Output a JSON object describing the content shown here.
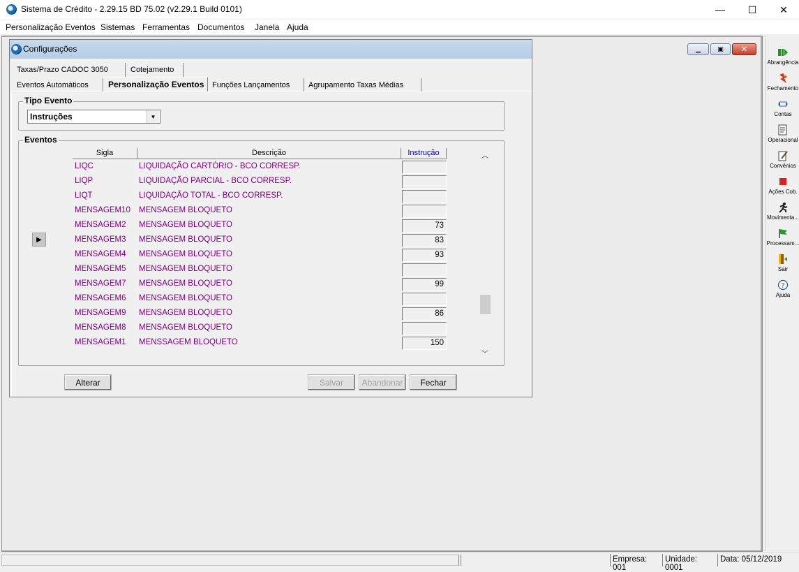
{
  "app": {
    "title": "Sistema de Crédito - 2.29.15 BD 75.02 (v2.29.1 Build 0101)",
    "controls": {
      "minimize": "—",
      "maximize": "☐",
      "close": "✕"
    }
  },
  "menu": {
    "items": [
      "Personalização Eventos",
      "Sistemas",
      "Ferramentas",
      "Documentos",
      "Janela",
      "Ajuda"
    ]
  },
  "toolbar": {
    "items": [
      {
        "label": "Abrangência",
        "icon": "abrangencia-icon"
      },
      {
        "label": "Fechamento",
        "icon": "fechamento-icon"
      },
      {
        "label": "Contas",
        "icon": "contas-icon"
      },
      {
        "label": "Operacional",
        "icon": "operacional-icon"
      },
      {
        "label": "Convênios",
        "icon": "convenios-icon"
      },
      {
        "label": "Ações Cob.",
        "icon": "acoes-cob-icon"
      },
      {
        "label": "Movimenta...",
        "icon": "movimenta-icon"
      },
      {
        "label": "Processam...",
        "icon": "processam-icon"
      },
      {
        "label": "Sair",
        "icon": "sair-icon"
      },
      {
        "label": "Ajuda",
        "icon": "help-icon"
      }
    ]
  },
  "window": {
    "title": "Configurações",
    "tabs_row1": [
      "Taxas/Prazo CADOC 3050",
      "Cotejamento"
    ],
    "tabs_row2": [
      "Eventos Automáticos",
      "Personalização Eventos",
      "Funções Lançamentos",
      "Agrupamento Taxas Médias"
    ],
    "active_tab": "Personalização Eventos"
  },
  "tipo_evento": {
    "label": "Tipo Evento",
    "selected": "Instruções"
  },
  "eventos": {
    "label": "Eventos",
    "columns": {
      "sigla": "Sigla",
      "descricao": "Descrição",
      "instrucao": "Instrução"
    },
    "rows": [
      {
        "sigla": "LIQC",
        "descricao": "LIQUIDAÇÃO CARTÓRIO - BCO CORRESP.",
        "instrucao": ""
      },
      {
        "sigla": "LIQP",
        "descricao": "LIQUIDAÇÃO PARCIAL - BCO CORRESP.",
        "instrucao": ""
      },
      {
        "sigla": "LIQT",
        "descricao": "LIQUIDAÇÃO TOTAL - BCO CORRESP.",
        "instrucao": ""
      },
      {
        "sigla": "MENSAGEM10",
        "descricao": "MENSAGEM BLOQUETO",
        "instrucao": ""
      },
      {
        "sigla": "MENSAGEM2",
        "descricao": "MENSAGEM BLOQUETO",
        "instrucao": "73"
      },
      {
        "sigla": "MENSAGEM3",
        "descricao": "MENSAGEM BLOQUETO",
        "instrucao": "83"
      },
      {
        "sigla": "MENSAGEM4",
        "descricao": "MENSAGEM BLOQUETO",
        "instrucao": "93"
      },
      {
        "sigla": "MENSAGEM5",
        "descricao": "MENSAGEM BLOQUETO",
        "instrucao": ""
      },
      {
        "sigla": "MENSAGEM7",
        "descricao": "MENSAGEM BLOQUETO",
        "instrucao": "99"
      },
      {
        "sigla": "MENSAGEM6",
        "descricao": "MENSAGEM BLOQUETO",
        "instrucao": ""
      },
      {
        "sigla": "MENSAGEM9",
        "descricao": "MENSAGEM BLOQUETO",
        "instrucao": "86"
      },
      {
        "sigla": "MENSAGEM8",
        "descricao": "MENSAGEM BLOQUETO",
        "instrucao": ""
      },
      {
        "sigla": "MENSAGEM1",
        "descricao": "MENSSAGEM BLOQUETO",
        "instrucao": "150"
      }
    ],
    "selected_row": 5
  },
  "buttons": {
    "alterar": "Alterar",
    "salvar": "Salvar",
    "abandonar": "Abandonar",
    "fechar": "Fechar"
  },
  "status": {
    "empresa": "Empresa: 001",
    "unidade": "Unidade: 0001",
    "data": "Data:  05/12/2019"
  },
  "colors": {
    "purple_text": "#800080",
    "instrucao_header": "#0000a0"
  }
}
